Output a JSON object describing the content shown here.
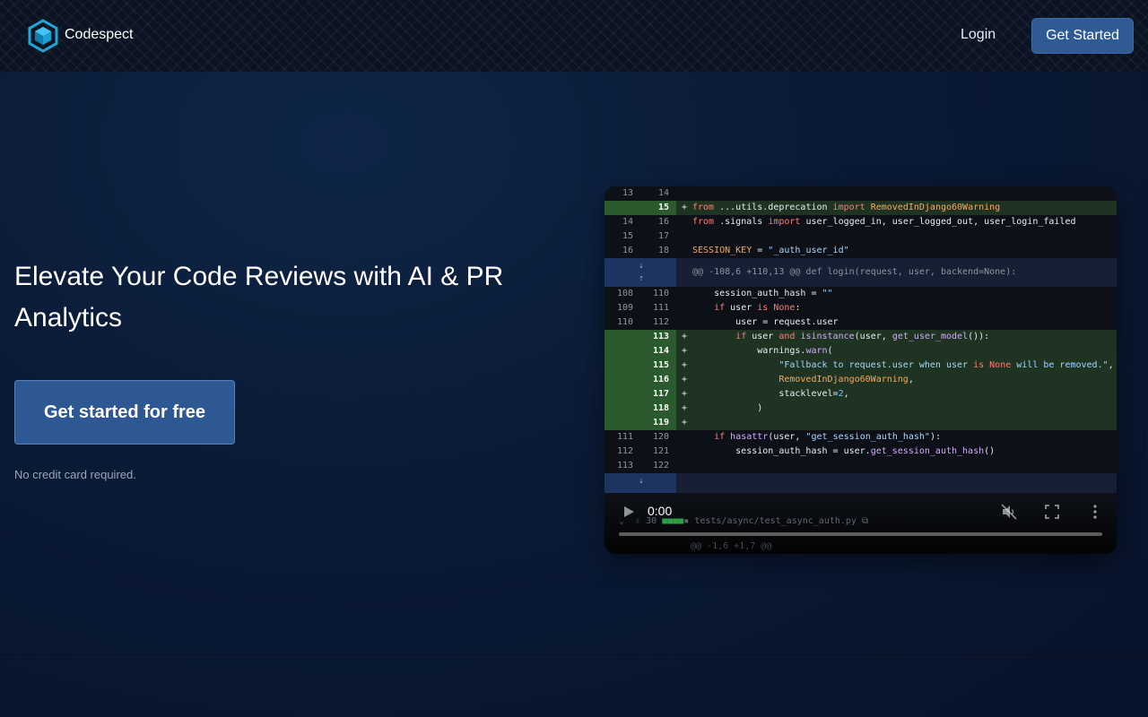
{
  "header": {
    "brand": "Codespect",
    "login_label": "Login",
    "get_started_label": "Get Started",
    "accent_color": "#2f5a93"
  },
  "hero": {
    "title": "Elevate Your Code Reviews with AI & PR Analytics",
    "cta_label": "Get started for free",
    "note": "No credit card required."
  },
  "video": {
    "time": "0:00",
    "progress": 0,
    "ghost_file_count": "30",
    "ghost_file_name": "tests/async/test_async_auth.py",
    "ghost_hunk": "@@ -1,6 +1,7 @@",
    "diff": [
      {
        "type": "ctx",
        "old": "13",
        "new": "14",
        "sign": "",
        "code": ""
      },
      {
        "type": "add",
        "old": "",
        "new": "15",
        "sign": "+",
        "code": "from ...utils.deprecation import RemovedInDjango60Warning"
      },
      {
        "type": "ctx",
        "old": "14",
        "new": "16",
        "sign": "",
        "code": "from .signals import user_logged_in, user_logged_out, user_login_failed"
      },
      {
        "type": "ctx",
        "old": "15",
        "new": "17",
        "sign": "",
        "code": ""
      },
      {
        "type": "ctx",
        "old": "16",
        "new": "18",
        "sign": "",
        "code": "SESSION_KEY = \"_auth_user_id\""
      },
      {
        "type": "hunk",
        "old": "",
        "new": "",
        "sign": "",
        "code": "@@ -108,6 +110,13 @@ def login(request, user, backend=None):"
      },
      {
        "type": "ctx",
        "old": "108",
        "new": "110",
        "sign": "",
        "code": "    session_auth_hash = \"\""
      },
      {
        "type": "ctx",
        "old": "109",
        "new": "111",
        "sign": "",
        "code": "    if user is None:"
      },
      {
        "type": "ctx",
        "old": "110",
        "new": "112",
        "sign": "",
        "code": "        user = request.user"
      },
      {
        "type": "add",
        "old": "",
        "new": "113",
        "sign": "+",
        "code": "        if user and isinstance(user, get_user_model()):"
      },
      {
        "type": "add",
        "old": "",
        "new": "114",
        "sign": "+",
        "code": "            warnings.warn("
      },
      {
        "type": "add",
        "old": "",
        "new": "115",
        "sign": "+",
        "code": "                \"Fallback to request.user when user is None will be removed.\","
      },
      {
        "type": "add",
        "old": "",
        "new": "116",
        "sign": "+",
        "code": "                RemovedInDjango60Warning,"
      },
      {
        "type": "add",
        "old": "",
        "new": "117",
        "sign": "+",
        "code": "                stacklevel=2,"
      },
      {
        "type": "add",
        "old": "",
        "new": "118",
        "sign": "+",
        "code": "            )"
      },
      {
        "type": "add",
        "old": "",
        "new": "119",
        "sign": "+",
        "code": ""
      },
      {
        "type": "ctx",
        "old": "111",
        "new": "120",
        "sign": "",
        "code": "    if hasattr(user, \"get_session_auth_hash\"):"
      },
      {
        "type": "ctx",
        "old": "112",
        "new": "121",
        "sign": "",
        "code": "        session_auth_hash = user.get_session_auth_hash()"
      },
      {
        "type": "ctx",
        "old": "113",
        "new": "122",
        "sign": "",
        "code": ""
      }
    ]
  }
}
